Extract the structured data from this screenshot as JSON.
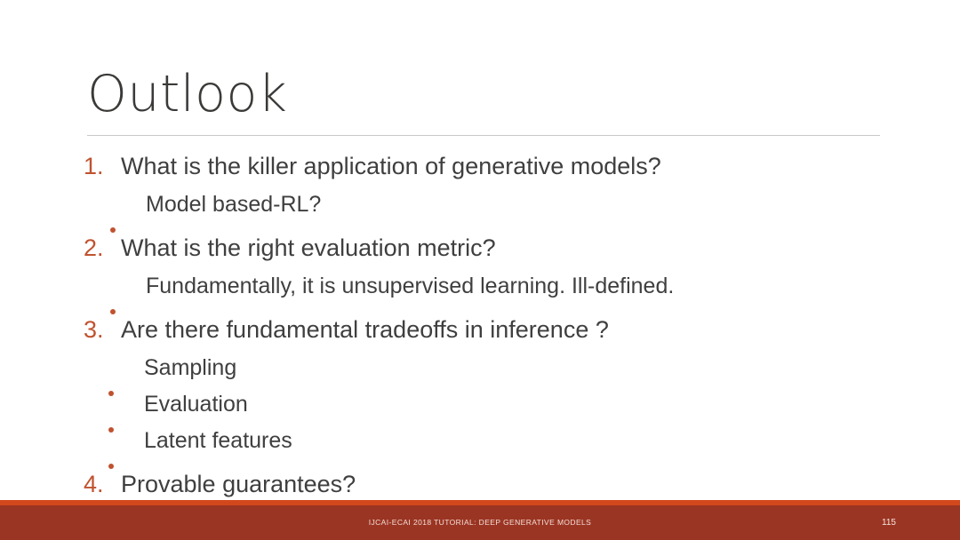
{
  "slide": {
    "title": "Outlook",
    "title_color": "#3b3a38",
    "background_color": "#ffffff",
    "rule_color": "#c9c9c9",
    "accent_color": "#c0522f",
    "body_text_color": "#3f3f3f"
  },
  "items": [
    {
      "marker": "1.",
      "text": "What is the killer application of generative models?"
    },
    {
      "bullet": "bullet-dot",
      "text": "Model based-RL?"
    },
    {
      "marker": "2.",
      "text": "What is the right evaluation metric?"
    },
    {
      "bullet": "bullet-dot",
      "text": "Fundamentally, it is unsupervised learning. Ill-defined."
    },
    {
      "marker": "3.",
      "text": "Are there fundamental tradeoffs in inference ?"
    },
    {
      "bullet": "bullet-dot",
      "text": "Sampling"
    },
    {
      "bullet": "bullet-dot",
      "text": "Evaluation"
    },
    {
      "bullet": "bullet-dot",
      "text": "Latent features"
    },
    {
      "marker": "4.",
      "text": "Provable guarantees?"
    }
  ],
  "footer": {
    "text": "IJCAI-ECAI 2018 TUTORIAL: DEEP GENERATIVE MODELS",
    "page_number": "115",
    "stripe_color": "#d2481c",
    "bar_color": "#9b3523",
    "text_color": "#f3ded7"
  }
}
